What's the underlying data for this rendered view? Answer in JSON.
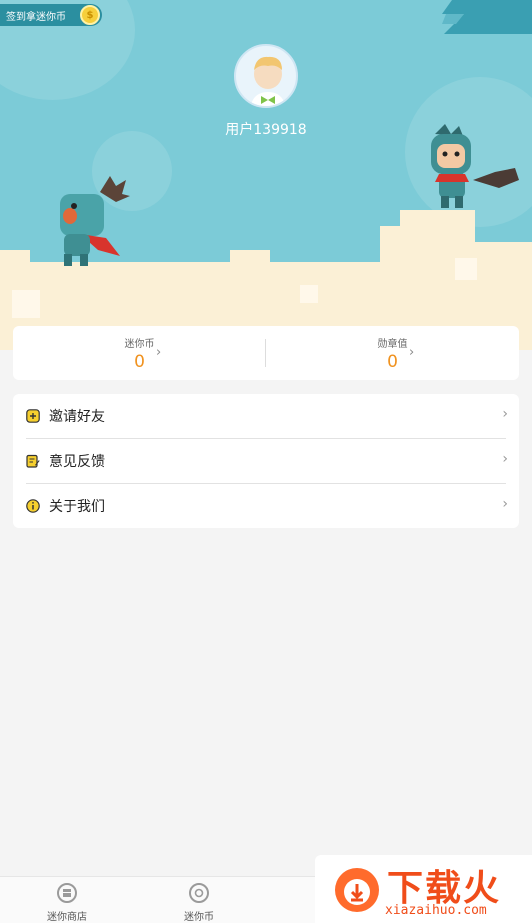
{
  "header": {
    "sign_in_badge": "签到拿迷你币",
    "coin_icon": "coin-icon",
    "username": "用户139918"
  },
  "stats": {
    "coins_label": "迷你币",
    "coins_value": "0",
    "medals_label": "勋章值",
    "medals_value": "0"
  },
  "menu": {
    "items": [
      {
        "label": "邀请好友",
        "icon": "plus-square-icon"
      },
      {
        "label": "意见反馈",
        "icon": "feedback-icon"
      },
      {
        "label": "关于我们",
        "icon": "info-icon"
      }
    ]
  },
  "bottom_nav": {
    "items": [
      {
        "label": "迷你商店",
        "icon": "shop-icon"
      },
      {
        "label": "迷你币",
        "icon": "coin-nav-icon"
      }
    ]
  },
  "watermark": {
    "brand": "下载火",
    "domain": "xiazaihuo.com"
  },
  "colors": {
    "sky": "#7ccbd7",
    "accent": "#f0921f",
    "watermark": "#f04d1a"
  }
}
